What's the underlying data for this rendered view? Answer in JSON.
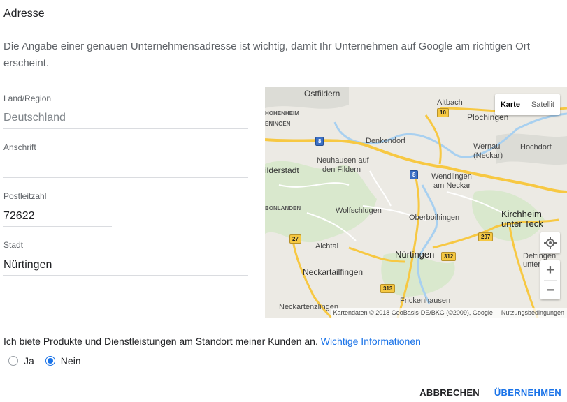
{
  "dialog": {
    "title": "Adresse",
    "description": "Die Angabe einer genauen Unternehmensadresse ist wichtig, damit Ihr Unternehmen auf Google am richtigen Ort erscheint."
  },
  "form": {
    "country": {
      "label": "Land/Region",
      "value": "Deutschland"
    },
    "street": {
      "label": "Anschrift",
      "value": ""
    },
    "zip": {
      "label": "Postleitzahl",
      "value": "72622"
    },
    "city": {
      "label": "Stadt",
      "value": "Nürtingen"
    }
  },
  "map": {
    "type_map": "Karte",
    "type_satellite": "Satellit",
    "zoom_in": "+",
    "zoom_out": "−",
    "attribution": "Kartendaten © 2018 GeoBasis-DE/BKG (©2009), Google",
    "terms": "Nutzungsbedingungen",
    "labels": {
      "ostfildern": "Ostfildern",
      "altbach": "Altbach",
      "plochingen": "Plochingen",
      "hohenheim": "HOHENHEIM",
      "enigen": "ENINGEN",
      "denkendorf": "Denkendorf",
      "wernau1": "Wernau",
      "wernau2": "(Neckar)",
      "hochdorf": "Hochdorf",
      "filderstadt": "ilderstadt",
      "neuhausen1": "Neuhausen auf",
      "neuhausen2": "den Fildern",
      "wendlingen1": "Wendlingen",
      "wendlingen2": "am Neckar",
      "bonlanden": "BONLANDEN",
      "wolfschlugen": "Wolfschlugen",
      "oberboihingen": "Oberboihingen",
      "kirchheim1": "Kirchheim",
      "kirchheim2": "unter Teck",
      "aichtal": "Aichtal",
      "nuertingen": "Nürtingen",
      "dettingen1": "Dettingen",
      "dettingen2": "unter Teck",
      "neckartailfingen": "Neckartailfingen",
      "frickenhausen": "Frickenhausen",
      "neckartenzlingen": "Neckartenzlingen"
    },
    "roads": {
      "r10": "10",
      "r8a": "8",
      "r8b": "8",
      "r27": "27",
      "r297": "297",
      "r312": "312",
      "r313": "313"
    },
    "colors": {
      "highway": "#f7c842",
      "water": "#a8d0f0",
      "land": "#eceae4",
      "green": "#cfe5c0"
    }
  },
  "service_area": {
    "question": "Ich biete Produkte und Dienstleistungen am Standort meiner Kunden an.",
    "link": "Wichtige Informationen",
    "options": {
      "yes": "Ja",
      "no": "Nein"
    },
    "selected": "no"
  },
  "actions": {
    "cancel": "ABBRECHEN",
    "apply": "ÜBERNEHMEN"
  },
  "theme": {
    "accent": "#1a73e8",
    "muted_text": "#5f6368"
  }
}
